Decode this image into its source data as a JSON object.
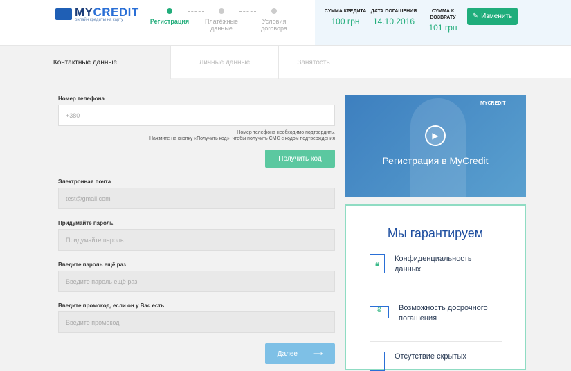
{
  "header": {
    "logo_my": "MY",
    "logo_credit": "CREDIT",
    "logo_sub": "онлайн кредиты на карту",
    "steps": [
      {
        "label": "Регистрация"
      },
      {
        "label": "Платёжные данные"
      },
      {
        "label": "Условия договора"
      }
    ],
    "summary": [
      {
        "label": "СУММА КРЕДИТА",
        "value": "100 грн"
      },
      {
        "label": "ДАТА ПОГАШЕНИЯ",
        "value": "14.10.2016"
      },
      {
        "label": "СУММА К ВОЗВРАТУ",
        "value": "101 грн"
      }
    ],
    "change_label": "Изменить"
  },
  "tabs": [
    {
      "label": "Контактные данные"
    },
    {
      "label": "Личные данные"
    },
    {
      "label": "Занятость"
    }
  ],
  "form": {
    "phone_label": "Номер телефона",
    "phone_placeholder": "+380",
    "hint1": "Номер телефона необходимо подтвердить.",
    "hint2": "Нажмите на кнопку «Получить код», чтобы получить СМС с кодом подтверждения",
    "get_code": "Получить код",
    "email_label": "Электронная почта",
    "email_value": "test@gmail.com",
    "pass_label": "Придумайте пароль",
    "pass_placeholder": "Придумайте пароль",
    "pass2_label": "Введите пароль ещё раз",
    "pass2_placeholder": "Введите пароль ещё раз",
    "promo_label": "Введите промокод, если он у Вас есть",
    "promo_placeholder": "Введите промокод",
    "next": "Далее"
  },
  "video": {
    "title": "Регистрация в MyCredit",
    "logo": "MYCREDIT"
  },
  "guarantee": {
    "title": "Мы гарантируем",
    "items": [
      {
        "text": "Конфиденциальность данных"
      },
      {
        "text": "Возможность досрочного погашения"
      },
      {
        "text": "Отсутствие скрытых"
      }
    ]
  },
  "colors": {
    "accent": "#1fad7b",
    "brand": "#1e3f7a"
  }
}
